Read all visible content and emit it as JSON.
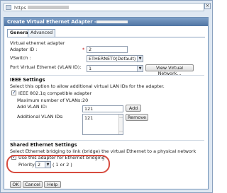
{
  "browser": {
    "url_prefix": "https"
  },
  "dialog": {
    "title": "Create Virtual Ethernet Adapter -"
  },
  "tabs": [
    {
      "label": "General"
    },
    {
      "label": "Advanced"
    }
  ],
  "general": {
    "section_label": "Virtual ethernet adapter",
    "adapter_id_label": "Adapter ID :",
    "adapter_id_value": "2",
    "vswitch_label": "VSwitch :",
    "vswitch_value": "ETHERNET0(Default)",
    "port_vlan_label": "Port Virtual Ethernet (VLAN ID):",
    "port_vlan_value": "1",
    "view_network_button": "View Virtual Network..."
  },
  "ieee": {
    "heading": "IEEE Settings",
    "description": "Select this option to allow additional virtual LAN IDs for the adapter.",
    "checkbox_label": "IEEE 802.1q compatible adapter",
    "max_vlans_label": "Maximum number of VLANs:",
    "max_vlans_value": "20",
    "add_vlan_label": "Add VLAN ID:",
    "add_vlan_value": "121",
    "add_button": "Add",
    "additional_label": "Additional VLAN IDs:",
    "additional_items": [
      "121"
    ],
    "remove_button": "Remove"
  },
  "shared": {
    "heading": "Shared Ethernet Settings",
    "description": "Select Ethernet bridging to link (bridge) the virtual Ethernet to a physical network",
    "checkbox_label": "Use this adapter for Ethernet bridging",
    "priority_label": "Priority:",
    "priority_value": "2",
    "priority_range": "( 1 or 2 )"
  },
  "footer": {
    "ok": "OK",
    "cancel": "Cancel",
    "help": "Help"
  }
}
